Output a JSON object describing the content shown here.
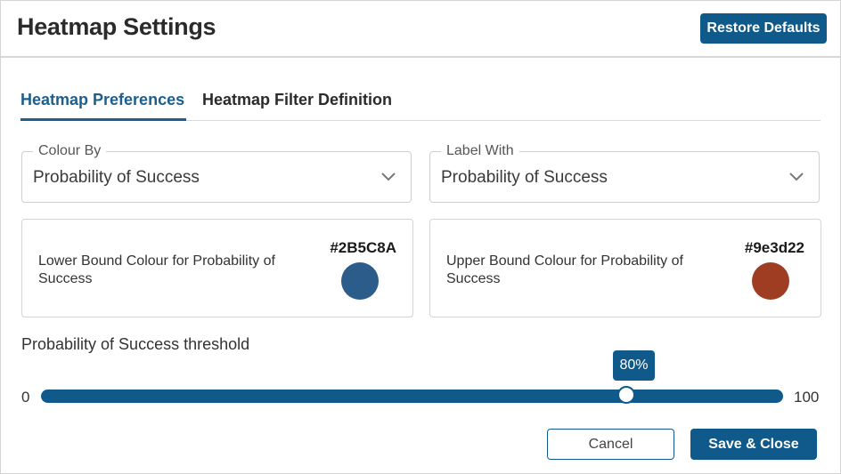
{
  "header": {
    "title": "Heatmap Settings",
    "restore_label": "Restore Defaults"
  },
  "tabs": [
    {
      "label": "Heatmap Preferences",
      "active": true
    },
    {
      "label": "Heatmap Filter Definition",
      "active": false
    }
  ],
  "colour_by": {
    "legend": "Colour By",
    "value": "Probability of Success"
  },
  "label_with": {
    "legend": "Label With",
    "value": "Probability of Success"
  },
  "lower_bound": {
    "label": "Lower Bound Colour for Probability of Success",
    "hex_label": "#2B5C8A",
    "color": "#2B5C8A"
  },
  "upper_bound": {
    "label": "Upper Bound Colour for Probability of Success",
    "hex_label": "#9e3d22",
    "color": "#9e3d22"
  },
  "threshold": {
    "label": "Probability of Success threshold",
    "min": "0",
    "max": "100",
    "value": 80,
    "value_label": "80%"
  },
  "footer": {
    "cancel_label": "Cancel",
    "save_label": "Save & Close"
  },
  "colors": {
    "accent": "#0f5a8a"
  }
}
